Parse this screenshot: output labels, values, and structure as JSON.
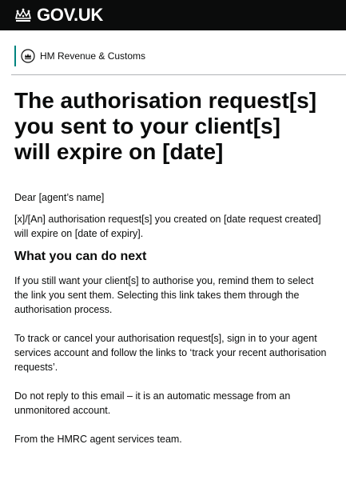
{
  "header": {
    "brand": "GOV.UK",
    "department": "HM Revenue & Customs"
  },
  "email": {
    "title": "The authorisation request[s] you sent to your client[s] will expire on [date]",
    "greeting": "Dear [agent’s name]",
    "intro": "[x]/[An] authorisation request[s] you created on [date request created] will expire on [date of expiry].",
    "next_heading": "What you can do next",
    "next_paragraph": "If you still want your client[s] to authorise you, remind them to select the link you sent them. Selecting this link takes them through the authorisation process.",
    "track_paragraph": "To track or cancel your authorisation request[s], sign in to your agent services account and follow the links to ‘track your recent authorisation requests’.",
    "noreply_paragraph": "Do not reply to this email – it is an automatic message from an unmonitored account.",
    "signoff": "From the HMRC agent services team."
  },
  "colors": {
    "header_bg": "#0b0c0c",
    "department_accent": "#00847f",
    "text": "#0b0c0c"
  },
  "icons": {
    "brand_logo": "crown-icon",
    "department_logo": "hmrc-crest-icon"
  }
}
